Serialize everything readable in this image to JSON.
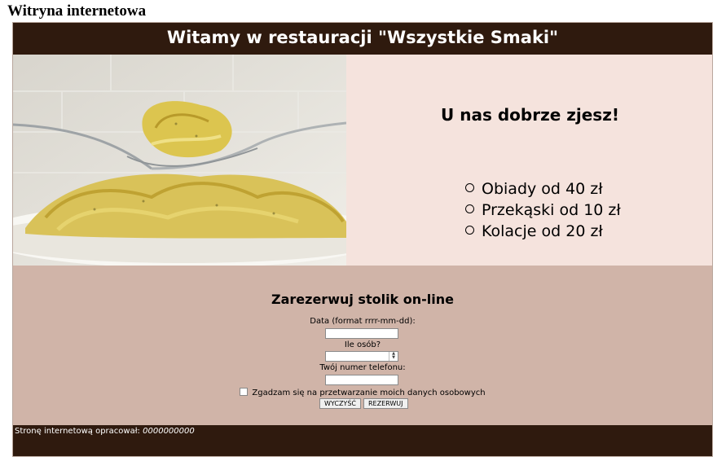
{
  "document": {
    "title": "Witryna internetowa"
  },
  "banner": {
    "title": "Witamy w restauracji \"Wszystkie Smaki\""
  },
  "promo": {
    "heading": "U nas dobrze zjesz!",
    "items": [
      "Obiady od 40 zł",
      "Przekąski od 10 zł",
      "Kolacje od 20 zł"
    ]
  },
  "reservation": {
    "heading": "Zarezerwuj stolik on-line",
    "date_label": "Data (format rrrr-mm-dd):",
    "guests_label": "Ile osób?",
    "phone_label": "Twój numer telefonu:",
    "consent_label": "Zgadzam się na przetwarzanie moich danych osobowych",
    "clear_button": "WYCZYŚĆ",
    "reserve_button": "REZERWUJ"
  },
  "footer": {
    "credit_label": "Stronę internetową opracował:",
    "author": "0000000000"
  },
  "icons": {
    "spinner_up": "triangle-up-icon",
    "spinner_down": "triangle-down-icon"
  },
  "colors": {
    "banner_bg": "#2f1a0e",
    "promo_bg": "#f5e3dd",
    "form_bg": "#d0b4a8"
  }
}
